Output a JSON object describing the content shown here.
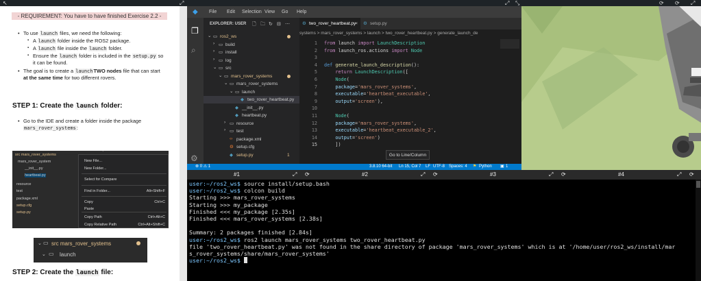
{
  "left_panel": {
    "requirement": "- REQUIREMENT: You have to have finished Exercise 2.2 -",
    "bullets": [
      {
        "pre": "To use ",
        "code": "launch",
        "post": " files, we need the following:"
      },
      {
        "pre": "A ",
        "code": "launch",
        "post": " folder inside the ROS2 package."
      },
      {
        "pre": "A ",
        "code": "launch",
        "post": " file inside the ",
        "code2": "launch",
        "post2": " folder."
      },
      {
        "pre": "Ensure the ",
        "code": "launch",
        "post": " folder is included in the ",
        "code2": "setup.py",
        "post2": " so"
      },
      {
        "text": "it can be found."
      },
      {
        "pre": "The goal is to create a ",
        "code": "launch",
        "post": " file that can start ",
        "bold": "TWO nodes"
      },
      {
        "bold": "at the same time",
        "post": " for two different rovers."
      }
    ],
    "step1": {
      "pre": "STEP 1: Create the ",
      "code": "launch",
      "post": " folder:"
    },
    "step1_bullet": {
      "text": "Go to the IDE and create a folder inside the package",
      "code": "mars_rover_systems",
      "post": ":"
    },
    "context_menu": {
      "tree": [
        "src  mars_rover_systems",
        "mars_rover_system",
        "__init__.py",
        "heartbeat.py",
        "resource",
        "test",
        "package.xml",
        "setup.cfg",
        "setup.py"
      ],
      "items": [
        {
          "label": "New File...",
          "shortcut": ""
        },
        {
          "label": "New Folder...",
          "shortcut": ""
        },
        {
          "label": "Select for Compare",
          "shortcut": ""
        },
        {
          "label": "Find in Folder...",
          "shortcut": "Alt+Shift+F"
        },
        {
          "label": "Copy",
          "shortcut": "Ctrl+C"
        },
        {
          "label": "Paste",
          "shortcut": ""
        },
        {
          "label": "Copy Path",
          "shortcut": "Ctrl+Alt+C"
        },
        {
          "label": "Copy Relative Path",
          "shortcut": "Ctrl+Alt+Shift+C"
        }
      ],
      "number": "4"
    },
    "folder_image": {
      "row1": "src  mars_rover_systems",
      "row2": "launch"
    },
    "step2": {
      "pre": "STEP 2: Create the ",
      "code": "launch",
      "post": " file:"
    }
  },
  "vscode": {
    "menu": [
      "File",
      "Edit",
      "Selection",
      "View",
      "Go",
      "Help"
    ],
    "explorer_title": "EXPLORER: USER",
    "tree": [
      {
        "label": "ros2_ws",
        "depth": 0,
        "kind": "folder-open",
        "dot": true
      },
      {
        "label": "build",
        "depth": 1,
        "kind": "folder"
      },
      {
        "label": "install",
        "depth": 1,
        "kind": "folder"
      },
      {
        "label": "log",
        "depth": 1,
        "kind": "folder"
      },
      {
        "label": "src",
        "depth": 1,
        "kind": "folder-open"
      },
      {
        "label": "mars_rover_systems",
        "depth": 2,
        "kind": "folder-open",
        "dot": true
      },
      {
        "label": "mars_rover_systems",
        "depth": 3,
        "kind": "folder-open"
      },
      {
        "label": "launch",
        "depth": 4,
        "kind": "folder-open"
      },
      {
        "label": "two_rover_heartbeat.py",
        "depth": 5,
        "kind": "py",
        "selected": true
      },
      {
        "label": "__init__.py",
        "depth": 4,
        "kind": "py"
      },
      {
        "label": "heartbeat.py",
        "depth": 4,
        "kind": "py"
      },
      {
        "label": "resource",
        "depth": 3,
        "kind": "folder"
      },
      {
        "label": "test",
        "depth": 3,
        "kind": "folder"
      },
      {
        "label": "package.xml",
        "depth": 3,
        "kind": "xml"
      },
      {
        "label": "setup.cfg",
        "depth": 3,
        "kind": "cfg"
      },
      {
        "label": "setup.py",
        "depth": 3,
        "kind": "py",
        "modified": "1"
      }
    ],
    "tabs": [
      {
        "label": "two_rover_heartbeat.py",
        "active": true
      },
      {
        "label": "setup.py",
        "active": false
      }
    ],
    "breadcrumb": "systems  >  mars_rover_systems  >  launch  >  two_rover_heartbeat.py  >  generate_launch_de",
    "code_lines": [
      "from launch import LaunchDescription",
      "from launch_ros.actions import Node",
      "",
      "def generate_launch_description():",
      "    return LaunchDescription([",
      "    Node(",
      "    package='mars_rover_systems',",
      "    executable='heartbeat_executable',",
      "    output='screen'),",
      "",
      "    Node(",
      "    package='mars_rover_systems',",
      "    executable='heartbeat_executable_2',",
      "    output='screen')",
      "    ])"
    ],
    "line_numbers": [
      "1",
      "2",
      "3",
      "4",
      "5",
      "6",
      "7",
      "8",
      "9",
      "10",
      "11",
      "12",
      "13",
      "14",
      "15"
    ],
    "goto_line": "Go to Line/Column",
    "status": {
      "problems": "⊗ 0 ⚠ 1",
      "python": "3.8.10 64-bit",
      "position": "Ln 15, Col 7",
      "eol": "LF",
      "encoding": "UTF-8",
      "spaces": "Spaces: 4",
      "language": "Python",
      "count": "1"
    }
  },
  "terminal": {
    "tabs": [
      "#1",
      "#2",
      "#3",
      "#4"
    ],
    "lines": [
      {
        "prompt": "user:~/ros2_ws$",
        "text": " source install/setup.bash"
      },
      {
        "prompt": "user:~/ros2_ws$",
        "text": " colcon build"
      },
      {
        "text": "Starting >>> mars_rover_systems"
      },
      {
        "text": "Starting >>> my_package"
      },
      {
        "text": "Finished <<< my_package [2.35s]"
      },
      {
        "text": "Finished <<< mars_rover_systems [2.38s]"
      },
      {
        "text": ""
      },
      {
        "text": "Summary: 2 packages finished [2.84s]"
      },
      {
        "prompt": "user:~/ros2_ws$",
        "text": " ros2 launch mars_rover_systems two_rover_heartbeat.py"
      },
      {
        "text": "file 'two_rover_heartbeat.py' was not found in the share directory of package 'mars_rover_systems' which is at '/home/user/ros2_ws/install/mar"
      },
      {
        "text": "s_rover_systems/share/mars_rover_systems'"
      },
      {
        "prompt": "user:~/ros2_ws$",
        "text": " ",
        "cursor": true
      }
    ]
  },
  "colors": {
    "accent": "#007acc",
    "prompt": "#7ec8ff",
    "req_bg": "#f2d4d4"
  }
}
